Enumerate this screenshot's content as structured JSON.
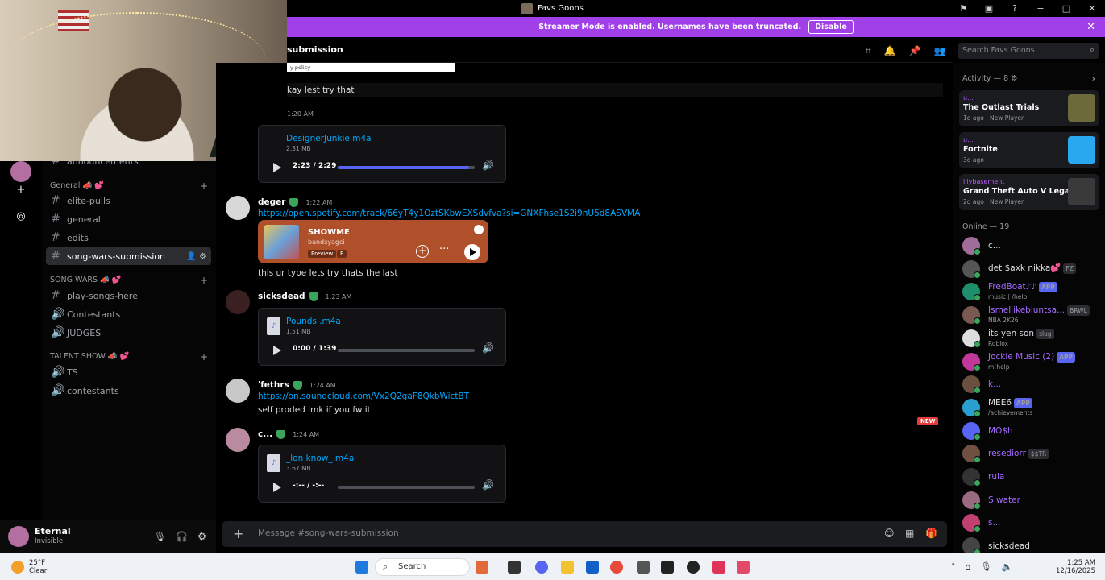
{
  "window": {
    "title": "Favs Goons",
    "controls": [
      "−",
      "□",
      "✕"
    ]
  },
  "banner": {
    "text": "Streamer Mode is enabled. Usernames have been truncated.",
    "button": "Disable",
    "close": "✕"
  },
  "sidebar": {
    "top_partial": "announcements",
    "categories": [
      {
        "name": "General 📣 💕",
        "channels": [
          "elite-pulls",
          "general",
          "edits",
          "song-wars-submission"
        ]
      },
      {
        "name": "SONG WARS 📣 💕",
        "channels": [
          "play-songs-here",
          "Contestants",
          "JUDGES"
        ]
      },
      {
        "name": "TALENT SHOW 📣 💕",
        "channels": [
          "TS",
          "contestants"
        ]
      }
    ],
    "selected": "song-wars-submission"
  },
  "user": {
    "name": "Eternal",
    "status": "Invisible"
  },
  "header": {
    "channel": "submission",
    "search_placeholder": "Search Favs Goons"
  },
  "chat": {
    "embed_partial": "y policy",
    "m0_text": "kay lest try that",
    "m1": {
      "time": "1:20 AM",
      "file": "DesignerJunkie.m4a",
      "size": "2.31 MB",
      "progress": "2:23 / 2:29",
      "pct": 0.96
    },
    "m2": {
      "author": "deger",
      "time": "1:22 AM",
      "link": "https://open.spotify.com/track/66yT4y1OztSKbwEXSdvfva?si=GNXFhse1S2i9nU5d8ASVMA",
      "spotify": {
        "title": "SHOWME",
        "artist": "bandsyagci",
        "preview": "Preview",
        "explicit": "E"
      },
      "text": "this ur type lets try thats the last"
    },
    "m3": {
      "author": "sicksdead",
      "time": "1:23 AM",
      "file": "Pounds .m4a",
      "size": "1.51 MB",
      "progress": "0:00 / 1:39",
      "pct": 0.0
    },
    "m4": {
      "author": "'fethrs",
      "time": "1:24 AM",
      "link": "https://on.soundcloud.com/Vx2Q2gaF8QkbWictBT",
      "text": "self proded lmk if you fw it"
    },
    "new_label": "NEW",
    "m5": {
      "author": "c...",
      "time": "1:24 AM",
      "file": "_lon know_.m4a",
      "size": "3.67 MB",
      "progress": "-:-- / -:--",
      "pct": 0.0
    },
    "composer_placeholder": "Message #song-wars-submission"
  },
  "activity": {
    "header": "Activity — 8",
    "cards": [
      {
        "user": "u...",
        "game": "The Outlast Trials",
        "meta": "1d ago",
        "badge": "New Player",
        "color": "#6c6a3a"
      },
      {
        "user": "u...",
        "game": "Fortnite",
        "meta": "3d ago",
        "badge": "",
        "color": "#29a8f0"
      },
      {
        "user": "illybasement",
        "game": "Grand Theft Auto V Legacy",
        "meta": "2d ago",
        "badge": "New Player",
        "color": "#3a3a3a"
      }
    ]
  },
  "online": {
    "header": "Online — 19",
    "members": [
      {
        "name": "c...",
        "sub": "",
        "tag": "",
        "color": "#dbdee1",
        "av": "#a06c9a"
      },
      {
        "name": "det $axk nikka💕",
        "sub": "",
        "tag": "FZ",
        "color": "#dbdee1",
        "av": "#555"
      },
      {
        "name": "FredBoat♪♪",
        "sub": "music | /help",
        "tag": "APP",
        "color": "#a56bff",
        "av": "#1e8f6a"
      },
      {
        "name": "Ismellikebluntsa...",
        "sub": "NBA 2K26",
        "tag": "BRWL",
        "color": "#a56bff",
        "av": "#7a5a50"
      },
      {
        "name": "its yen son",
        "sub": "Roblox",
        "tag": "slug",
        "color": "#dbdee1",
        "av": "#ddd"
      },
      {
        "name": "Jockie Music (2)",
        "sub": "m!help",
        "tag": "APP",
        "color": "#a56bff",
        "av": "#c0389c"
      },
      {
        "name": "k...",
        "sub": "",
        "tag": "",
        "color": "#a56bff",
        "av": "#6b5040"
      },
      {
        "name": "MEE6",
        "sub": "/achievements",
        "tag": "APP",
        "color": "#dbdee1",
        "av": "#2aa0d0"
      },
      {
        "name": "MO$h",
        "sub": "",
        "tag": "",
        "color": "#a56bff",
        "av": "#5865f2"
      },
      {
        "name": "resediorr",
        "sub": "",
        "tag": "$$TR",
        "color": "#a56bff",
        "av": "#705040"
      },
      {
        "name": "rula",
        "sub": "",
        "tag": "",
        "color": "#a56bff",
        "av": "#333"
      },
      {
        "name": "S water",
        "sub": "",
        "tag": "",
        "color": "#a56bff",
        "av": "#9a6a80"
      },
      {
        "name": "s...",
        "sub": "",
        "tag": "",
        "color": "#a56bff",
        "av": "#c04070"
      },
      {
        "name": "sicksdead",
        "sub": "",
        "tag": "",
        "color": "#dbdee1",
        "av": "#444"
      }
    ]
  },
  "taskbar": {
    "temp": "25°F",
    "weather": "Clear",
    "search": "Search",
    "time": "1:25 AM",
    "date": "12/16/2025"
  }
}
